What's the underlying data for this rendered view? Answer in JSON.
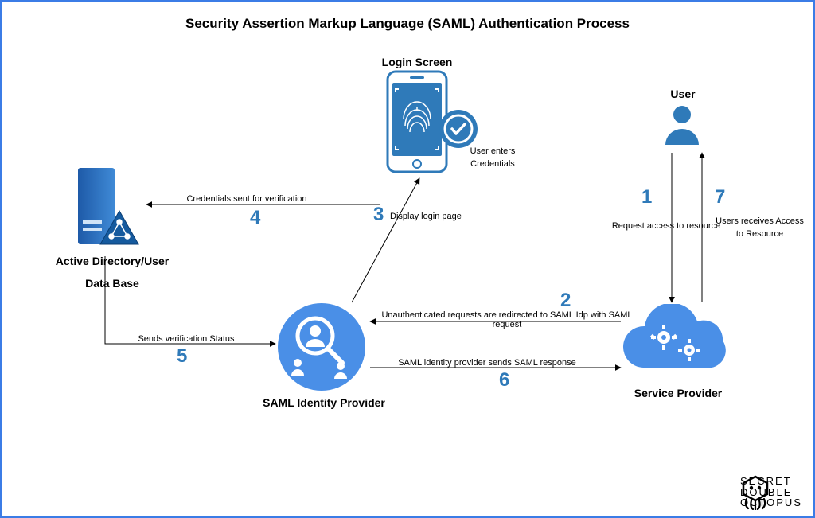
{
  "title": "Security Assertion Markup Language (SAML) Authentication Process",
  "nodes": {
    "login_screen": "Login Screen",
    "user": "User",
    "active_directory_l1": "Active Directory/User",
    "active_directory_l2": "Data Base",
    "saml_idp": "SAML Identity Provider",
    "service_provider": "Service Provider"
  },
  "notes": {
    "user_enters_credentials_l1": "User enters",
    "user_enters_credentials_l2": "Credentials"
  },
  "steps": {
    "s1": {
      "num": "1",
      "label": "Request access to resource"
    },
    "s2": {
      "num": "2",
      "label": "Unauthenticated requests are redirected to SAML Idp with SAML request"
    },
    "s3": {
      "num": "3",
      "label": "Display login page"
    },
    "s4": {
      "num": "4",
      "label": "Credentials sent for verification"
    },
    "s5": {
      "num": "5",
      "label": "Sends verification Status"
    },
    "s6": {
      "num": "6",
      "label": "SAML identity provider sends SAML response"
    },
    "s7": {
      "num": "7",
      "label_l1": "Users receives Access",
      "label_l2": "to Resource"
    }
  },
  "brand": {
    "l1": "SECRET",
    "l2": "DOUBLE",
    "l3": "OCTOPUS"
  }
}
